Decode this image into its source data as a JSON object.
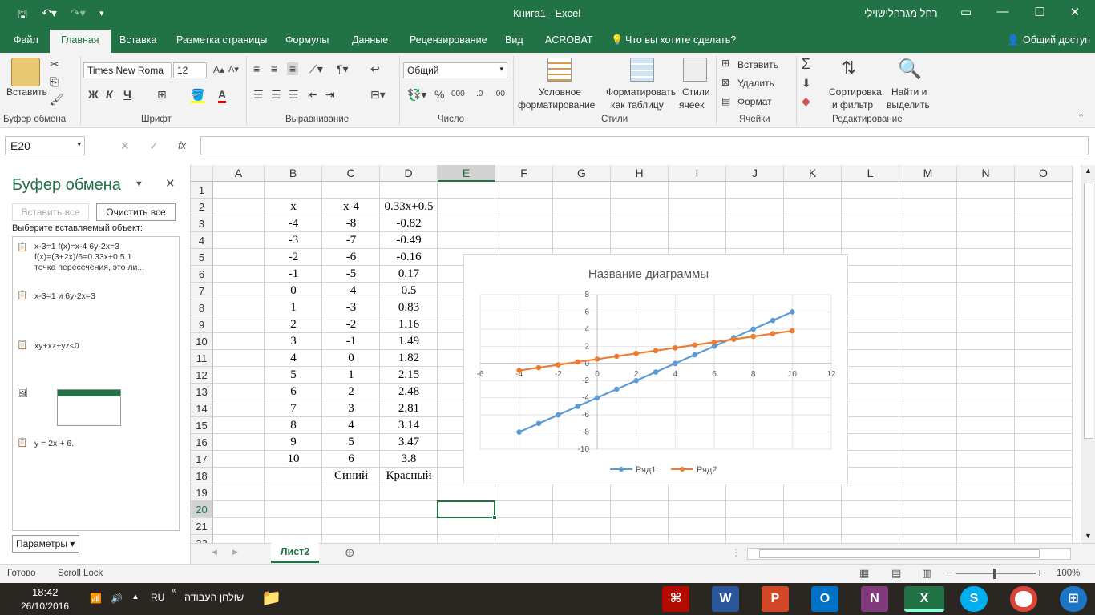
{
  "window": {
    "title": "Книга1  -  Excel",
    "user": "רחל מגרהלישוילי"
  },
  "tabs": [
    "Файл",
    "Главная",
    "Вставка",
    "Разметка страницы",
    "Формулы",
    "Данные",
    "Рецензирование",
    "Вид",
    "ACROBAT",
    "Что вы хотите сделать?"
  ],
  "share_label": "Общий доступ",
  "ribbon": {
    "paste": "Вставить",
    "font_name": "Times New Roma",
    "font_size": "12",
    "bold": "Ж",
    "italic": "К",
    "underline": "Ч",
    "number_format": "Общий",
    "cond_format_1": "Условное",
    "cond_format_2": "форматирование",
    "format_table_1": "Форматировать",
    "format_table_2": "как таблицу",
    "cell_styles_1": "Стили",
    "cell_styles_2": "ячеек",
    "insert": "Вставить",
    "delete": "Удалить",
    "format": "Формат",
    "sort_1": "Сортировка",
    "sort_2": "и фильтр",
    "find_1": "Найти и",
    "find_2": "выделить",
    "groups": {
      "clipboard": "Буфер обмена",
      "font": "Шрифт",
      "alignment": "Выравнивание",
      "number": "Число",
      "styles": "Стили",
      "cells": "Ячейки",
      "editing": "Редактирование"
    }
  },
  "formula_bar": {
    "name_box": "E20",
    "fx": "fx",
    "value": ""
  },
  "clipboard_pane": {
    "title": "Буфер обмена",
    "paste_all": "Вставить все",
    "clear_all": "Очистить все",
    "prompt": "Выберите вставляемый объект:",
    "items": [
      "x-3=1 f(x)=x-4 6y-2x=3",
      "f(x)=(3+2x)/6=0.33x+0.5 1",
      "точка пересечения, это ли...",
      "x-3=1 и 6y-2x=3",
      "xy+xz+yz<0",
      "y = 2x + 6."
    ],
    "options": "Параметры"
  },
  "grid": {
    "columns": [
      "A",
      "B",
      "C",
      "D",
      "E",
      "F",
      "G",
      "H",
      "I",
      "J",
      "K",
      "L",
      "M",
      "N",
      "O"
    ],
    "rows": [
      "1",
      "2",
      "3",
      "4",
      "5",
      "6",
      "7",
      "8",
      "9",
      "10",
      "11",
      "12",
      "13",
      "14",
      "15",
      "16",
      "17",
      "18",
      "19",
      "20",
      "21",
      "22"
    ],
    "headers": {
      "B": "x",
      "C": "x-4",
      "D": "0.33x+0.5"
    },
    "B": [
      "-4",
      "-3",
      "-2",
      "-1",
      "0",
      "1",
      "2",
      "3",
      "4",
      "5",
      "6",
      "7",
      "8",
      "9",
      "10"
    ],
    "C": [
      "-8",
      "-7",
      "-6",
      "-5",
      "-4",
      "-3",
      "-2",
      "-1",
      "0",
      "1",
      "2",
      "3",
      "4",
      "5",
      "6"
    ],
    "D": [
      "-0.82",
      "-0.49",
      "-0.16",
      "0.17",
      "0.5",
      "0.83",
      "1.16",
      "1.49",
      "1.82",
      "2.15",
      "2.48",
      "2.81",
      "3.14",
      "3.47",
      "3.8"
    ],
    "footer": {
      "C": "Синий",
      "D": "Красный"
    }
  },
  "chart_data": {
    "type": "line",
    "title": "Название диаграммы",
    "x": [
      -4,
      -3,
      -2,
      -1,
      0,
      1,
      2,
      3,
      4,
      5,
      6,
      7,
      8,
      9,
      10
    ],
    "series": [
      {
        "name": "Ряд1",
        "color": "#5b9bd5",
        "values": [
          -8,
          -7,
          -6,
          -5,
          -4,
          -3,
          -2,
          -1,
          0,
          1,
          2,
          3,
          4,
          5,
          6
        ]
      },
      {
        "name": "Ряд2",
        "color": "#ed7d31",
        "values": [
          -0.82,
          -0.49,
          -0.16,
          0.17,
          0.5,
          0.83,
          1.16,
          1.49,
          1.82,
          2.15,
          2.48,
          2.81,
          3.14,
          3.47,
          3.8
        ]
      }
    ],
    "xlim": [
      -6,
      12
    ],
    "ylim": [
      -10,
      8
    ],
    "xticks": [
      "-6",
      "-4",
      "-2",
      "0",
      "2",
      "4",
      "6",
      "8",
      "10",
      "12"
    ],
    "yticks": [
      "8",
      "6",
      "4",
      "2",
      "0",
      "-2",
      "-4",
      "-6",
      "-8",
      "-10"
    ],
    "grid": true,
    "legend": "bottom"
  },
  "sheet_tab": "Лист2",
  "status": {
    "ready": "Готово",
    "scroll_lock": "Scroll Lock",
    "zoom": "100%"
  },
  "taskbar": {
    "time": "18:42",
    "date": "26/10/2016",
    "lang": "RU",
    "desktop": "שולחן העבודה"
  }
}
